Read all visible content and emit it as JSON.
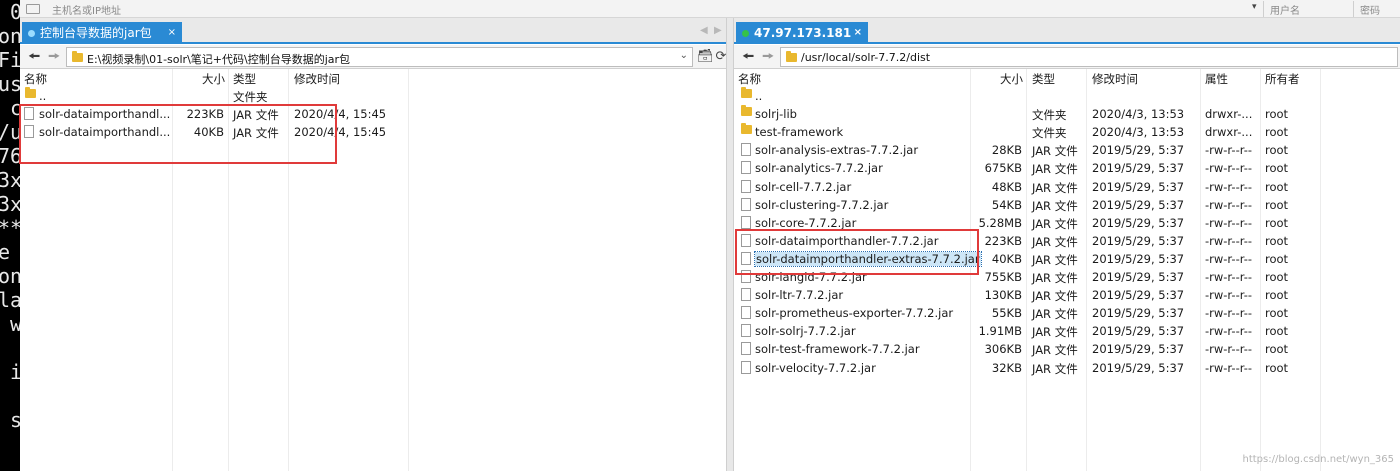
{
  "terminal": {
    "lines": [
      " 0",
      "on",
      "Fi",
      "us",
      " c",
      "/u",
      "76",
      "3x",
      "3x",
      "**",
      "e ",
      "on",
      "la",
      " w",
      "",
      " i",
      "",
      " s",
      ""
    ]
  },
  "address_bar": {
    "host_placeholder": "主机名或IP地址",
    "user_label": "用户名",
    "password_label": "密码",
    "dropdown_glyph": "▾"
  },
  "left": {
    "tab_title": "控制台导数据的jar包",
    "tab_close": "×",
    "path": "E:\\视频录制\\01-solr\\笔记+代码\\控制台导数据的jar包",
    "columns": {
      "name": "名称",
      "size": "大小",
      "type": "类型",
      "modified": "修改时间"
    },
    "rows": [
      {
        "name": "..",
        "size": "",
        "type": "文件夹",
        "modified": "",
        "kind": "folder"
      },
      {
        "name": "solr-dataimporthandl...",
        "size": "223KB",
        "type": "JAR 文件",
        "modified": "2020/4/4, 15:45",
        "kind": "file"
      },
      {
        "name": "solr-dataimporthandl...",
        "size": "40KB",
        "type": "JAR 文件",
        "modified": "2020/4/4, 15:45",
        "kind": "file"
      }
    ]
  },
  "right": {
    "tab_title": "47.97.173.181",
    "tab_close": "×",
    "path": "/usr/local/solr-7.7.2/dist",
    "columns": {
      "name": "名称",
      "size": "大小",
      "type": "类型",
      "modified": "修改时间",
      "attrs": "属性",
      "owner": "所有者"
    },
    "rows": [
      {
        "name": "..",
        "size": "",
        "type": "",
        "modified": "",
        "attrs": "",
        "owner": "",
        "kind": "folder"
      },
      {
        "name": "solrj-lib",
        "size": "",
        "type": "文件夹",
        "modified": "2020/4/3, 13:53",
        "attrs": "drwxr-...",
        "owner": "root",
        "kind": "folder"
      },
      {
        "name": "test-framework",
        "size": "",
        "type": "文件夹",
        "modified": "2020/4/3, 13:53",
        "attrs": "drwxr-...",
        "owner": "root",
        "kind": "folder"
      },
      {
        "name": "solr-analysis-extras-7.7.2.jar",
        "size": "28KB",
        "type": "JAR 文件",
        "modified": "2019/5/29, 5:37",
        "attrs": "-rw-r--r--",
        "owner": "root",
        "kind": "file"
      },
      {
        "name": "solr-analytics-7.7.2.jar",
        "size": "675KB",
        "type": "JAR 文件",
        "modified": "2019/5/29, 5:37",
        "attrs": "-rw-r--r--",
        "owner": "root",
        "kind": "file"
      },
      {
        "name": "solr-cell-7.7.2.jar",
        "size": "48KB",
        "type": "JAR 文件",
        "modified": "2019/5/29, 5:37",
        "attrs": "-rw-r--r--",
        "owner": "root",
        "kind": "file"
      },
      {
        "name": "solr-clustering-7.7.2.jar",
        "size": "54KB",
        "type": "JAR 文件",
        "modified": "2019/5/29, 5:37",
        "attrs": "-rw-r--r--",
        "owner": "root",
        "kind": "file"
      },
      {
        "name": "solr-core-7.7.2.jar",
        "size": "5.28MB",
        "type": "JAR 文件",
        "modified": "2019/5/29, 5:37",
        "attrs": "-rw-r--r--",
        "owner": "root",
        "kind": "file"
      },
      {
        "name": "solr-dataimporthandler-7.7.2.jar",
        "size": "223KB",
        "type": "JAR 文件",
        "modified": "2019/5/29, 5:37",
        "attrs": "-rw-r--r--",
        "owner": "root",
        "kind": "file"
      },
      {
        "name": "solr-dataimporthandler-extras-7.7.2.jar",
        "size": "40KB",
        "type": "JAR 文件",
        "modified": "2019/5/29, 5:37",
        "attrs": "-rw-r--r--",
        "owner": "root",
        "kind": "file",
        "selected": true
      },
      {
        "name": "solr-langid-7.7.2.jar",
        "size": "755KB",
        "type": "JAR 文件",
        "modified": "2019/5/29, 5:37",
        "attrs": "-rw-r--r--",
        "owner": "root",
        "kind": "file"
      },
      {
        "name": "solr-ltr-7.7.2.jar",
        "size": "130KB",
        "type": "JAR 文件",
        "modified": "2019/5/29, 5:37",
        "attrs": "-rw-r--r--",
        "owner": "root",
        "kind": "file"
      },
      {
        "name": "solr-prometheus-exporter-7.7.2.jar",
        "size": "55KB",
        "type": "JAR 文件",
        "modified": "2019/5/29, 5:37",
        "attrs": "-rw-r--r--",
        "owner": "root",
        "kind": "file"
      },
      {
        "name": "solr-solrj-7.7.2.jar",
        "size": "1.91MB",
        "type": "JAR 文件",
        "modified": "2019/5/29, 5:37",
        "attrs": "-rw-r--r--",
        "owner": "root",
        "kind": "file"
      },
      {
        "name": "solr-test-framework-7.7.2.jar",
        "size": "306KB",
        "type": "JAR 文件",
        "modified": "2019/5/29, 5:37",
        "attrs": "-rw-r--r--",
        "owner": "root",
        "kind": "file"
      },
      {
        "name": "solr-velocity-7.7.2.jar",
        "size": "32KB",
        "type": "JAR 文件",
        "modified": "2019/5/29, 5:37",
        "attrs": "-rw-r--r--",
        "owner": "root",
        "kind": "file"
      }
    ]
  },
  "watermark": "https://blog.csdn.net/wyn_365",
  "colors": {
    "tab_blue": "#2a8ad4",
    "highlight_red": "#e03a3a",
    "connected_green": "#35c24a",
    "folder_yellow": "#e9b82e",
    "selection_blue": "#cde6f7"
  }
}
